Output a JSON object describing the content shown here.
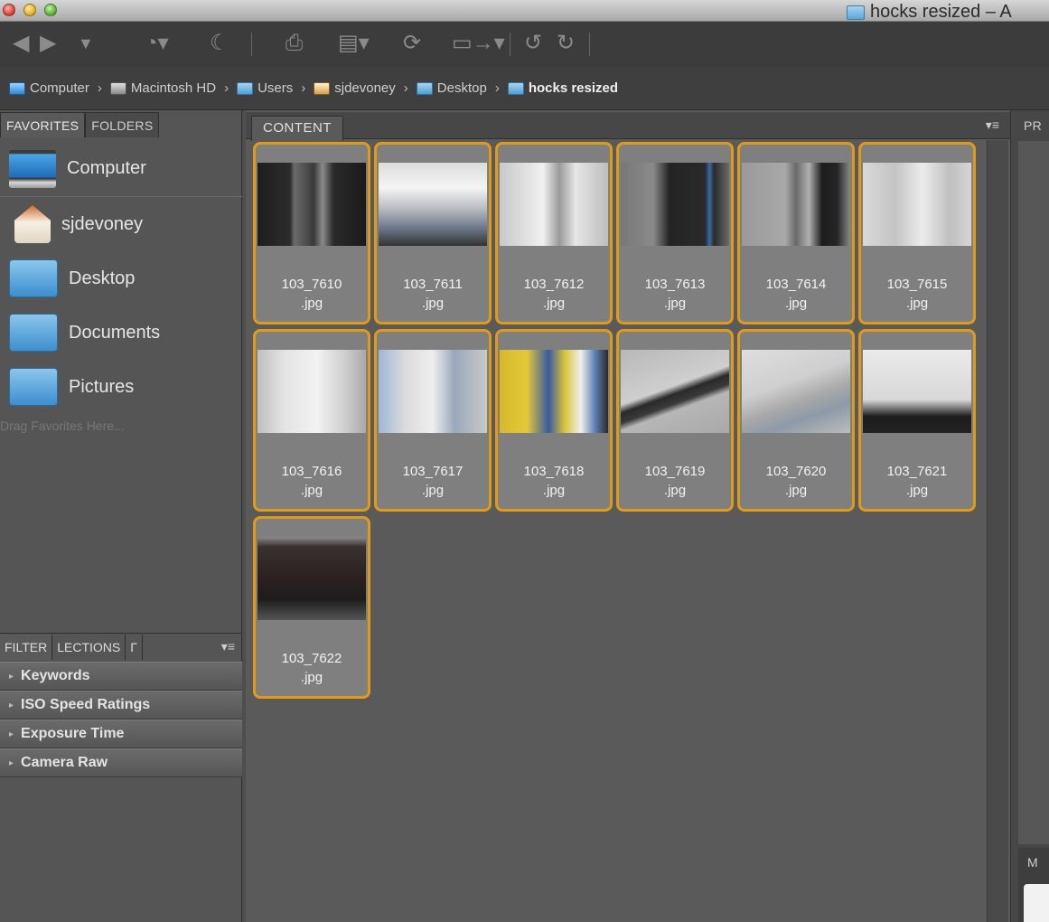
{
  "window": {
    "title": "hocks resized – A"
  },
  "toolbar": {
    "icons": [
      "back-arrow-icon",
      "forward-arrow-icon",
      "dropdown-icon",
      "recent-icon",
      "boomerang-icon",
      "get-photos-icon",
      "refine-icon",
      "camera-raw-icon",
      "output-icon",
      "rotate-left-icon",
      "rotate-right-icon"
    ]
  },
  "breadcrumb": [
    {
      "label": "Computer",
      "icon": "computer-icon"
    },
    {
      "label": "Macintosh HD",
      "icon": "hard-drive-icon"
    },
    {
      "label": "Users",
      "icon": "folder-icon"
    },
    {
      "label": "sjdevoney",
      "icon": "home-icon"
    },
    {
      "label": "Desktop",
      "icon": "folder-icon"
    },
    {
      "label": "hocks resized",
      "icon": "folder-icon"
    }
  ],
  "left_panel": {
    "tabs": [
      "FAVORITES",
      "FOLDERS"
    ],
    "favorites": [
      "Computer",
      "sjdevoney",
      "Desktop",
      "Documents",
      "Pictures"
    ],
    "drag_hint": "Drag Favorites Here...",
    "filter_tabs": [
      "FILTER",
      "LECTIONS",
      "Γ"
    ],
    "filter_items": [
      "Keywords",
      "ISO Speed Ratings",
      "Exposure Time",
      "Camera Raw"
    ]
  },
  "content": {
    "tab": "CONTENT",
    "files": [
      {
        "name": "103_7610",
        "ext": ".jpg"
      },
      {
        "name": "103_7611",
        "ext": ".jpg"
      },
      {
        "name": "103_7612",
        "ext": ".jpg"
      },
      {
        "name": "103_7613",
        "ext": ".jpg"
      },
      {
        "name": "103_7614",
        "ext": ".jpg"
      },
      {
        "name": "103_7615",
        "ext": ".jpg"
      },
      {
        "name": "103_7616",
        "ext": ".jpg"
      },
      {
        "name": "103_7617",
        "ext": ".jpg"
      },
      {
        "name": "103_7618",
        "ext": ".jpg"
      },
      {
        "name": "103_7619",
        "ext": ".jpg"
      },
      {
        "name": "103_7620",
        "ext": ".jpg"
      },
      {
        "name": "103_7621",
        "ext": ".jpg"
      },
      {
        "name": "103_7622",
        "ext": ".jpg"
      }
    ],
    "selection_color": "#e09a1a"
  },
  "right_panel": {
    "tab": "PR",
    "bottom_tab": "M"
  }
}
